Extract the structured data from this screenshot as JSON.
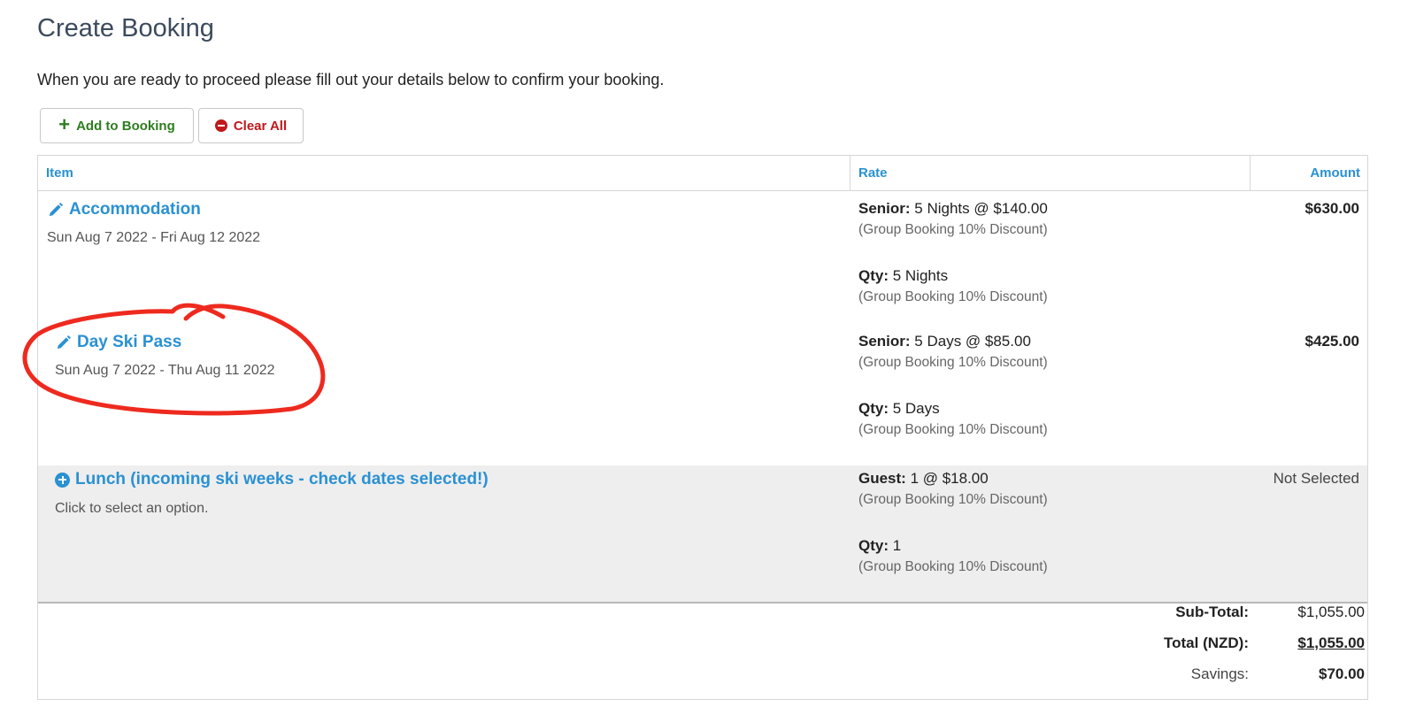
{
  "page": {
    "title": "Create Booking",
    "intro": "When you are ready to proceed please fill out your details below to confirm your booking."
  },
  "toolbar": {
    "add_label": "Add to Booking",
    "clear_label": "Clear All"
  },
  "table": {
    "headers": {
      "item": "Item",
      "rate": "Rate",
      "amount": "Amount"
    },
    "rows": [
      {
        "title": "Accommodation",
        "subtitle": "Sun Aug 7 2022 - Fri Aug 12 2022",
        "rate1_label": "Senior:",
        "rate1_value": " 5 Nights @ $140.00",
        "rate1_note": "(Group Booking 10% Discount)",
        "rate2_label": "Qty:",
        "rate2_value": " 5 Nights",
        "rate2_note": "(Group Booking 10% Discount)",
        "amount": "$630.00"
      },
      {
        "title": "Day Ski Pass",
        "subtitle": "Sun Aug 7 2022 - Thu Aug 11 2022",
        "rate1_label": "Senior:",
        "rate1_value": " 5 Days @ $85.00",
        "rate1_note": "(Group Booking 10% Discount)",
        "rate2_label": "Qty:",
        "rate2_value": " 5 Days",
        "rate2_note": "(Group Booking 10% Discount)",
        "amount": "$425.00",
        "highlighted": true
      },
      {
        "title": "Lunch (incoming ski weeks - check dates selected!)",
        "subtitle": "Click to select an option.",
        "rate1_label": "Guest:",
        "rate1_value": " 1 @ $18.00",
        "rate1_note": "(Group Booking 10% Discount)",
        "rate2_label": "Qty:",
        "rate2_value": " 1",
        "rate2_note": "(Group Booking 10% Discount)",
        "amount": "Not Selected"
      }
    ]
  },
  "totals": {
    "subtotal_label": "Sub-Total:",
    "subtotal_value": "$1,055.00",
    "total_label": "Total (NZD):",
    "total_value": "$1,055.00",
    "savings_label": "Savings:",
    "savings_value": "$70.00"
  },
  "colors": {
    "link": "#2a91d2",
    "add": "#2e7d1f",
    "clear": "#c0181d",
    "annotation": "#ee2a1f",
    "selected_row_bg": "#eeeeee"
  },
  "icons": [
    "plus-icon",
    "minus-circle-icon",
    "pencil-icon",
    "plus-circle-icon"
  ]
}
